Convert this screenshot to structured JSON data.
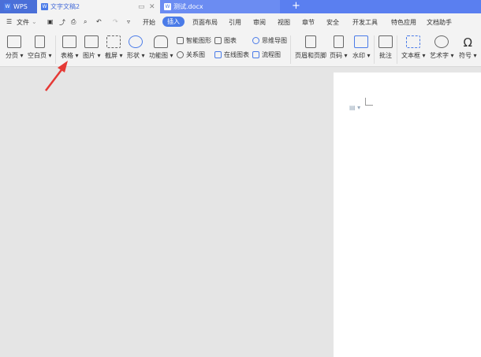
{
  "tabs": {
    "app": "WPS",
    "active_doc": "文字文稿2",
    "other_doc": "测试.docx",
    "new_tab": "+"
  },
  "menu": {
    "file": "文件",
    "items": [
      "开始",
      "插入",
      "页面布局",
      "引用",
      "审阅",
      "视图",
      "章节",
      "安全",
      "开发工具",
      "特色应用",
      "文档助手"
    ],
    "active": "插入"
  },
  "ribbon": {
    "big": [
      "分页",
      "空白页",
      "表格",
      "图片",
      "截屏",
      "形状",
      "功能图",
      "页眉和页脚",
      "页码",
      "水印",
      "批注",
      "文本框",
      "艺术字",
      "符号"
    ],
    "small": [
      "智能图形",
      "关系图",
      "图表",
      "在线图表",
      "思维导图",
      "流程图"
    ]
  },
  "colors": {
    "tabbar": "#5a7ff0",
    "accent": "#4a7be8",
    "arrow": "#e53935"
  }
}
